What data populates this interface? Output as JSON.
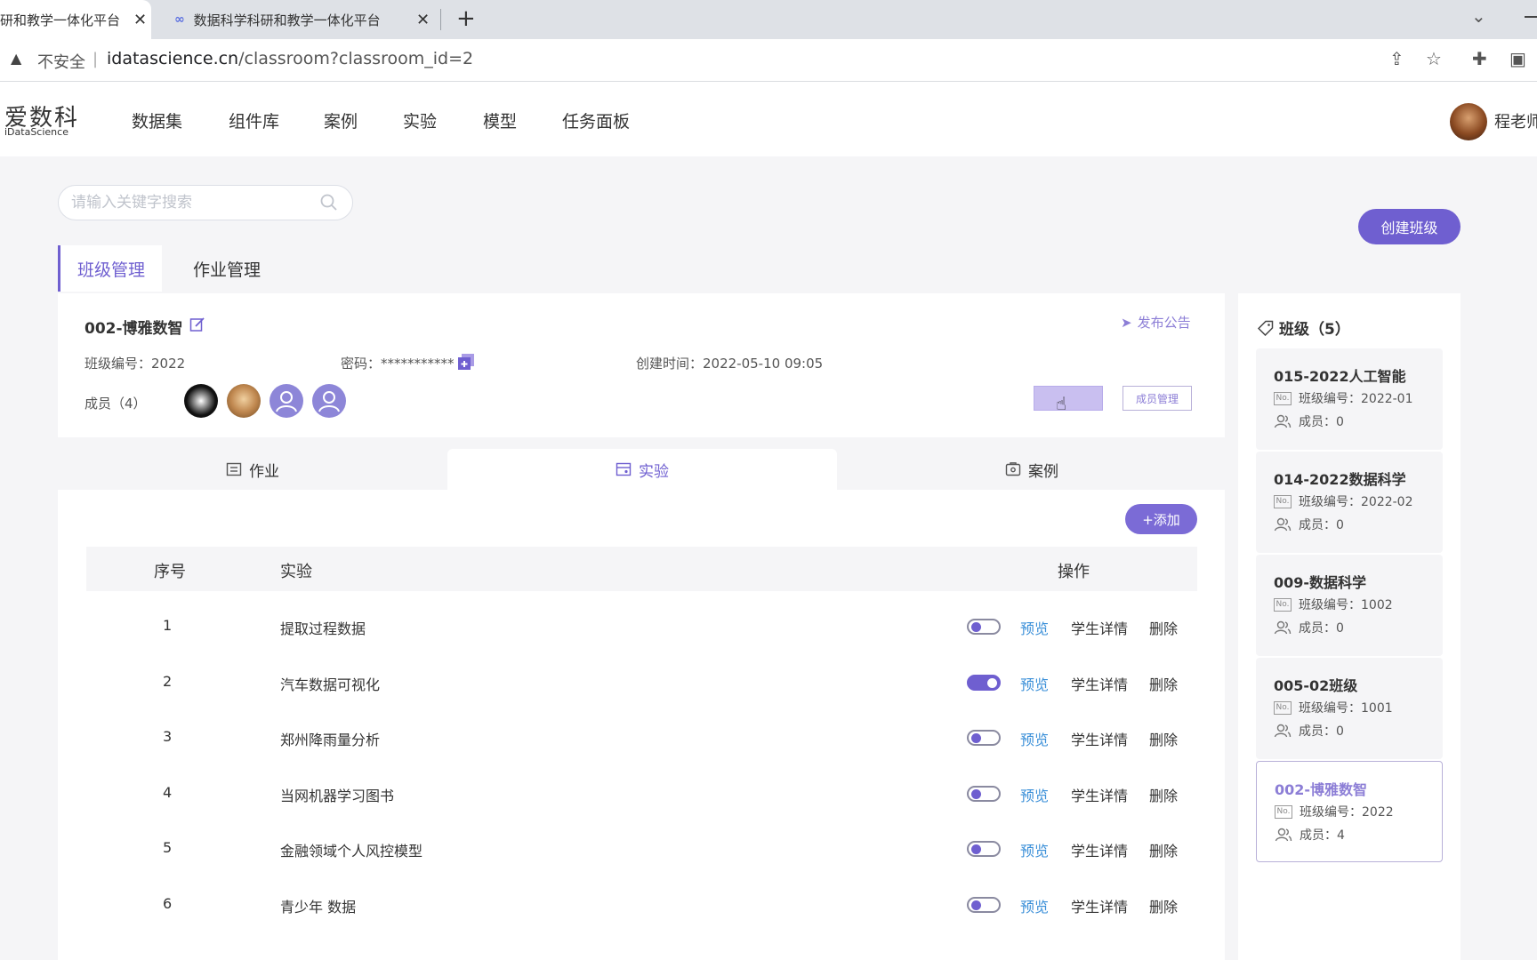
{
  "browser": {
    "tabs": [
      {
        "title": "研和教学一体化平台",
        "active": true
      },
      {
        "title": "数据科学科研和教学一体化平台",
        "active": false
      }
    ],
    "new_tab": "+",
    "insecure_label": "不安全",
    "url_host": "idatascience.cn",
    "url_path": "/classroom?classroom_id=2"
  },
  "app": {
    "logo_cn": "爱数科",
    "logo_en": "iDataScience",
    "nav": [
      "数据集",
      "组件库",
      "案例",
      "实验",
      "模型",
      "任务面板"
    ],
    "user_name": "程老师"
  },
  "search": {
    "placeholder": "请输入关键字搜索"
  },
  "create_button": "创建班级",
  "main_tabs": [
    "班级管理",
    "作业管理"
  ],
  "class_info": {
    "title": "002-博雅数智",
    "announce": "发布公告",
    "code_label": "班级编号：2022",
    "password_label": "密码：***********",
    "created_label": "创建时间：2022-05-10 09:05",
    "members_label": "成员（4）",
    "manage_button": "成员管理"
  },
  "sub_tabs": [
    "作业",
    "实验",
    "案例"
  ],
  "table": {
    "add_button": "+添加",
    "headers": [
      "序号",
      "实验",
      "操作"
    ],
    "rows": [
      {
        "idx": "1",
        "name": "提取过程数据",
        "enabled": false
      },
      {
        "idx": "2",
        "name": "汽车数据可视化",
        "enabled": true
      },
      {
        "idx": "3",
        "name": "郑州降雨量分析",
        "enabled": false
      },
      {
        "idx": "4",
        "name": "当网机器学习图书",
        "enabled": false
      },
      {
        "idx": "5",
        "name": "金融领域个人风控模型",
        "enabled": false
      },
      {
        "idx": "6",
        "name": "青少年 数据",
        "enabled": false
      }
    ],
    "ops": {
      "preview": "预览",
      "detail": "学生详情",
      "delete": "删除"
    }
  },
  "sidebar": {
    "title": "班级（5）",
    "classes": [
      {
        "name": "015-2022人工智能",
        "code": "班级编号：2022-01",
        "members": "成员：0",
        "active": false
      },
      {
        "name": "014-2022数据科学",
        "code": "班级编号：2022-02",
        "members": "成员：0",
        "active": false
      },
      {
        "name": "009-数据科学",
        "code": "班级编号：1002",
        "members": "成员：0",
        "active": false
      },
      {
        "name": "005-02班级",
        "code": "班级编号：1001",
        "members": "成员：0",
        "active": false
      },
      {
        "name": "002-博雅数智",
        "code": "班级编号：2022",
        "members": "成员：4",
        "active": true
      }
    ],
    "no_badge": "No."
  },
  "colors": {
    "accent": "#6f5fd0",
    "link": "#3a8fd8"
  }
}
